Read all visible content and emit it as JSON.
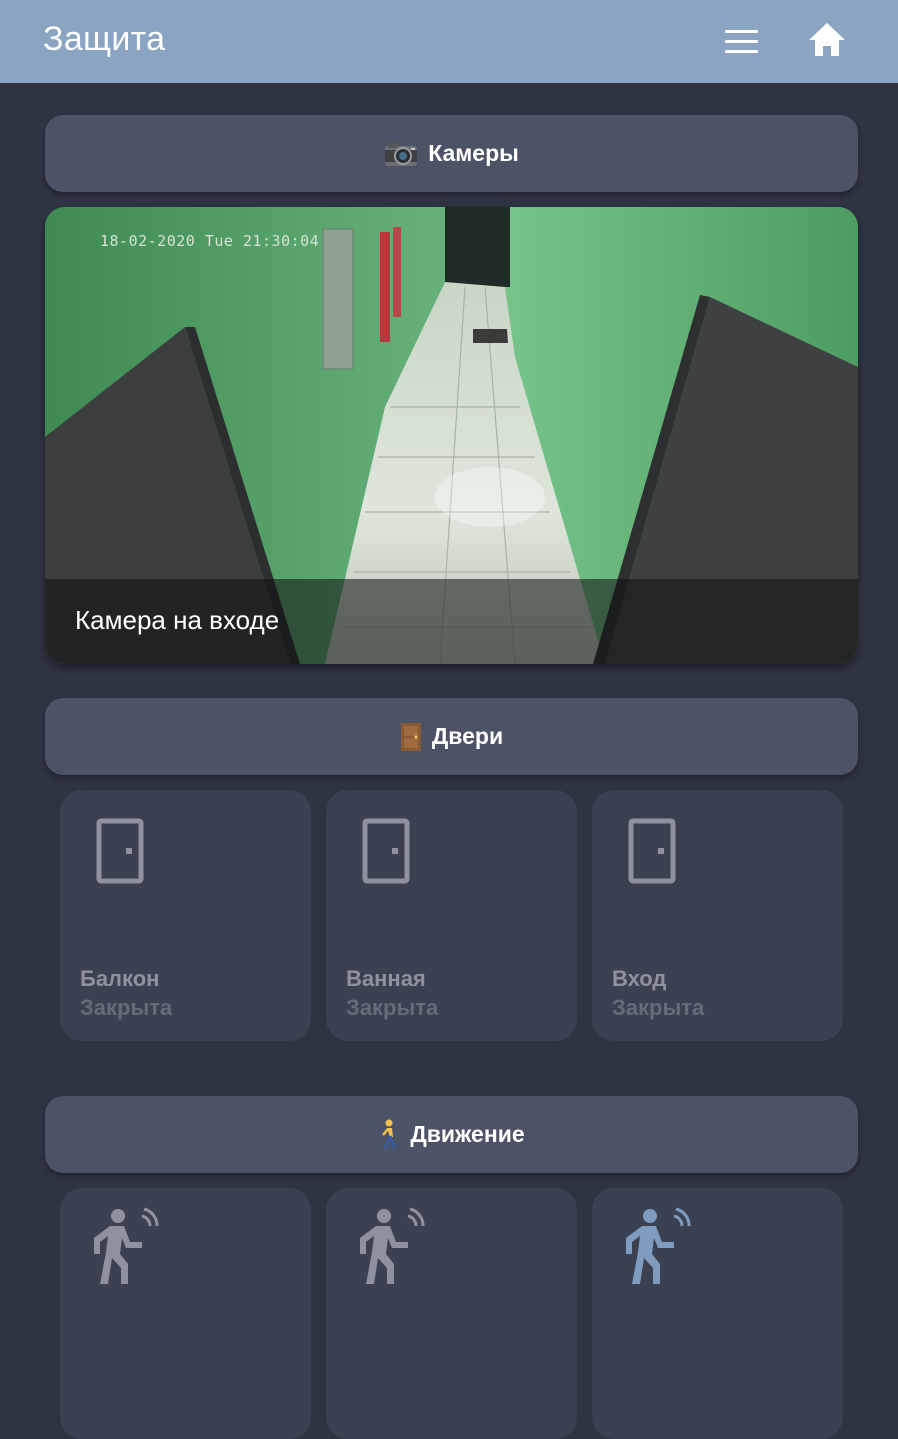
{
  "header": {
    "title": "Защита",
    "menu_icon": "hamburger-menu-icon",
    "home_icon": "home-icon"
  },
  "sections": {
    "cameras": {
      "emoji": "📷",
      "label": "Камеры"
    },
    "doors": {
      "emoji": "🚪",
      "label": "Двери"
    },
    "motion": {
      "emoji": "🚶",
      "label": "Движение"
    }
  },
  "camera": {
    "caption": "Камера на входе",
    "timestamp": "18-02-2020 Tue 21:30:04"
  },
  "doors": [
    {
      "name": "Балкон",
      "state": "Закрыта"
    },
    {
      "name": "Ванная",
      "state": "Закрыта"
    },
    {
      "name": "Вход",
      "state": "Закрыта"
    }
  ],
  "motion_sensors": [
    {
      "icon": "walk-motion-icon",
      "active": false
    },
    {
      "icon": "walk-motion-icon",
      "active": false
    },
    {
      "icon": "walk-motion-icon",
      "active": true
    }
  ],
  "colors": {
    "header_bg": "#8aa4c1",
    "page_bg": "#2f3443",
    "section_bg": "#4d5366",
    "tile_bg": "#3c4151",
    "icon_inactive": "#8e929e",
    "icon_active": "#7f9bbd"
  }
}
